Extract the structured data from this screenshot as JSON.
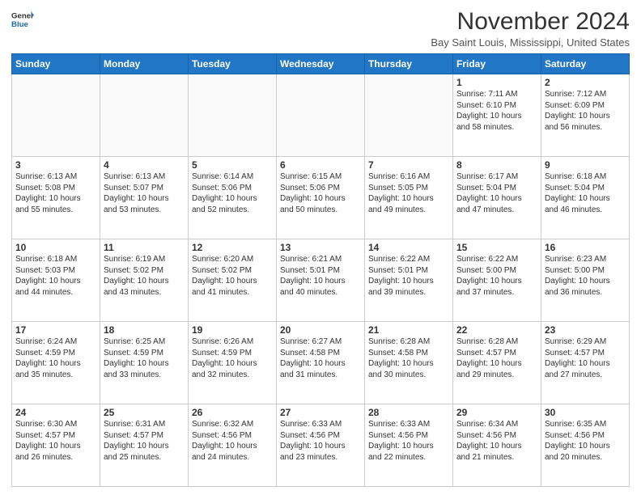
{
  "header": {
    "logo": {
      "line1": "General",
      "line2": "Blue"
    },
    "title": "November 2024",
    "location": "Bay Saint Louis, Mississippi, United States"
  },
  "weekdays": [
    "Sunday",
    "Monday",
    "Tuesday",
    "Wednesday",
    "Thursday",
    "Friday",
    "Saturday"
  ],
  "weeks": [
    [
      {
        "day": "",
        "empty": true
      },
      {
        "day": "",
        "empty": true
      },
      {
        "day": "",
        "empty": true
      },
      {
        "day": "",
        "empty": true
      },
      {
        "day": "",
        "empty": true
      },
      {
        "day": "1",
        "sunrise": "7:11 AM",
        "sunset": "6:10 PM",
        "daylight": "10 hours and 58 minutes."
      },
      {
        "day": "2",
        "sunrise": "7:12 AM",
        "sunset": "6:09 PM",
        "daylight": "10 hours and 56 minutes."
      }
    ],
    [
      {
        "day": "3",
        "sunrise": "6:13 AM",
        "sunset": "5:08 PM",
        "daylight": "10 hours and 55 minutes."
      },
      {
        "day": "4",
        "sunrise": "6:13 AM",
        "sunset": "5:07 PM",
        "daylight": "10 hours and 53 minutes."
      },
      {
        "day": "5",
        "sunrise": "6:14 AM",
        "sunset": "5:06 PM",
        "daylight": "10 hours and 52 minutes."
      },
      {
        "day": "6",
        "sunrise": "6:15 AM",
        "sunset": "5:06 PM",
        "daylight": "10 hours and 50 minutes."
      },
      {
        "day": "7",
        "sunrise": "6:16 AM",
        "sunset": "5:05 PM",
        "daylight": "10 hours and 49 minutes."
      },
      {
        "day": "8",
        "sunrise": "6:17 AM",
        "sunset": "5:04 PM",
        "daylight": "10 hours and 47 minutes."
      },
      {
        "day": "9",
        "sunrise": "6:18 AM",
        "sunset": "5:04 PM",
        "daylight": "10 hours and 46 minutes."
      }
    ],
    [
      {
        "day": "10",
        "sunrise": "6:18 AM",
        "sunset": "5:03 PM",
        "daylight": "10 hours and 44 minutes."
      },
      {
        "day": "11",
        "sunrise": "6:19 AM",
        "sunset": "5:02 PM",
        "daylight": "10 hours and 43 minutes."
      },
      {
        "day": "12",
        "sunrise": "6:20 AM",
        "sunset": "5:02 PM",
        "daylight": "10 hours and 41 minutes."
      },
      {
        "day": "13",
        "sunrise": "6:21 AM",
        "sunset": "5:01 PM",
        "daylight": "10 hours and 40 minutes."
      },
      {
        "day": "14",
        "sunrise": "6:22 AM",
        "sunset": "5:01 PM",
        "daylight": "10 hours and 39 minutes."
      },
      {
        "day": "15",
        "sunrise": "6:22 AM",
        "sunset": "5:00 PM",
        "daylight": "10 hours and 37 minutes."
      },
      {
        "day": "16",
        "sunrise": "6:23 AM",
        "sunset": "5:00 PM",
        "daylight": "10 hours and 36 minutes."
      }
    ],
    [
      {
        "day": "17",
        "sunrise": "6:24 AM",
        "sunset": "4:59 PM",
        "daylight": "10 hours and 35 minutes."
      },
      {
        "day": "18",
        "sunrise": "6:25 AM",
        "sunset": "4:59 PM",
        "daylight": "10 hours and 33 minutes."
      },
      {
        "day": "19",
        "sunrise": "6:26 AM",
        "sunset": "4:59 PM",
        "daylight": "10 hours and 32 minutes."
      },
      {
        "day": "20",
        "sunrise": "6:27 AM",
        "sunset": "4:58 PM",
        "daylight": "10 hours and 31 minutes."
      },
      {
        "day": "21",
        "sunrise": "6:28 AM",
        "sunset": "4:58 PM",
        "daylight": "10 hours and 30 minutes."
      },
      {
        "day": "22",
        "sunrise": "6:28 AM",
        "sunset": "4:57 PM",
        "daylight": "10 hours and 29 minutes."
      },
      {
        "day": "23",
        "sunrise": "6:29 AM",
        "sunset": "4:57 PM",
        "daylight": "10 hours and 27 minutes."
      }
    ],
    [
      {
        "day": "24",
        "sunrise": "6:30 AM",
        "sunset": "4:57 PM",
        "daylight": "10 hours and 26 minutes."
      },
      {
        "day": "25",
        "sunrise": "6:31 AM",
        "sunset": "4:57 PM",
        "daylight": "10 hours and 25 minutes."
      },
      {
        "day": "26",
        "sunrise": "6:32 AM",
        "sunset": "4:56 PM",
        "daylight": "10 hours and 24 minutes."
      },
      {
        "day": "27",
        "sunrise": "6:33 AM",
        "sunset": "4:56 PM",
        "daylight": "10 hours and 23 minutes."
      },
      {
        "day": "28",
        "sunrise": "6:33 AM",
        "sunset": "4:56 PM",
        "daylight": "10 hours and 22 minutes."
      },
      {
        "day": "29",
        "sunrise": "6:34 AM",
        "sunset": "4:56 PM",
        "daylight": "10 hours and 21 minutes."
      },
      {
        "day": "30",
        "sunrise": "6:35 AM",
        "sunset": "4:56 PM",
        "daylight": "10 hours and 20 minutes."
      }
    ]
  ]
}
